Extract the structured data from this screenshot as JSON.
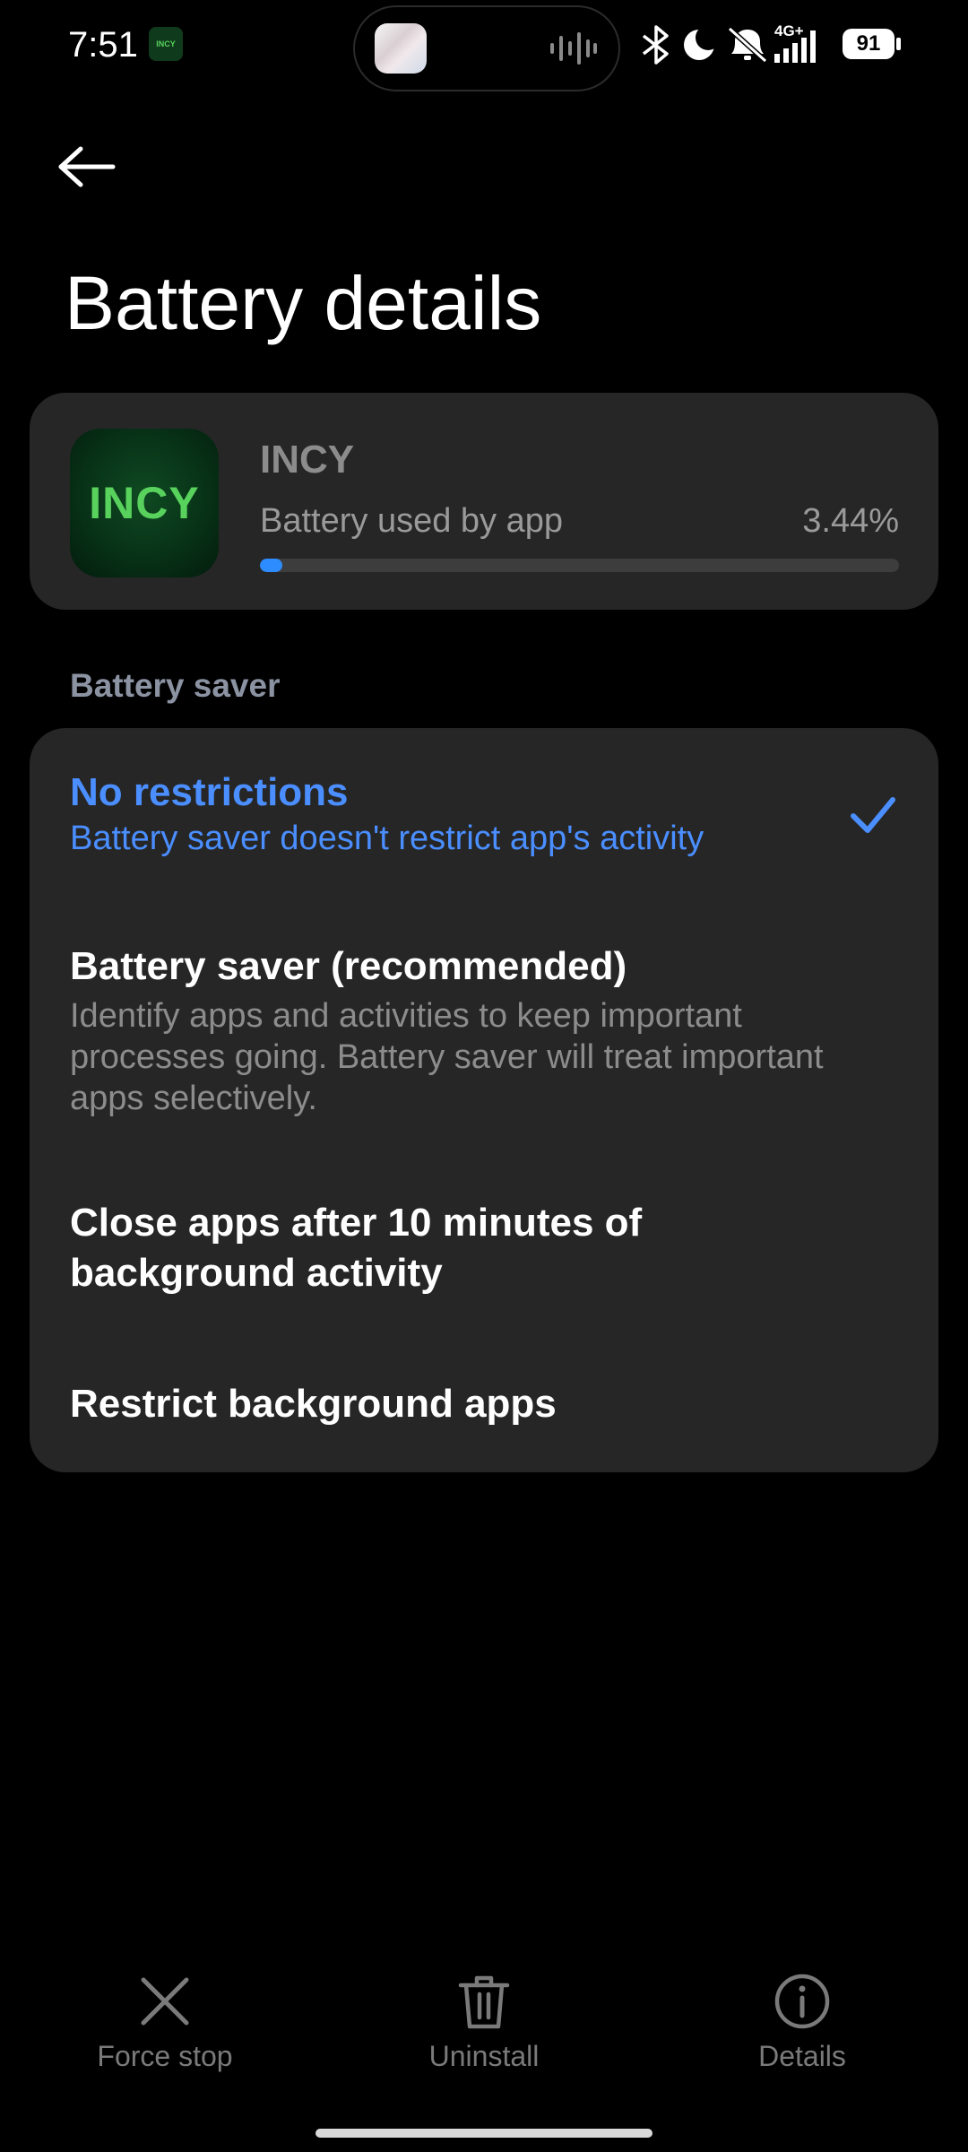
{
  "status_bar": {
    "time": "7:51",
    "app_icon_text": "INCY",
    "network": "4G+",
    "battery_level": "91"
  },
  "header": {
    "back_icon": "arrow-left-icon",
    "title": "Battery details"
  },
  "app": {
    "logo_text": "INCY",
    "name": "INCY",
    "usage_label": "Battery used by app",
    "usage_value": "3.44%",
    "usage_fraction": 0.0344,
    "accent_color": "#2d8cff"
  },
  "battery_saver": {
    "section_label": "Battery saver",
    "options": [
      {
        "title": "No restrictions",
        "subtitle": "Battery saver doesn't restrict app's activity",
        "selected": true
      },
      {
        "title": "Battery saver (recommended)",
        "subtitle": "Identify apps and activities to keep important processes going. Battery saver will treat important apps selectively.",
        "selected": false
      },
      {
        "title": "Close apps after 10 minutes of background activity",
        "selected": false
      },
      {
        "title": "Restrict background apps",
        "selected": false
      }
    ],
    "selected_color": "#4a8eff"
  },
  "bottom_bar": {
    "force_stop": {
      "label": "Force stop",
      "icon": "close-x-icon"
    },
    "uninstall": {
      "label": "Uninstall",
      "icon": "trash-icon"
    },
    "details": {
      "label": "Details",
      "icon": "info-icon"
    }
  }
}
